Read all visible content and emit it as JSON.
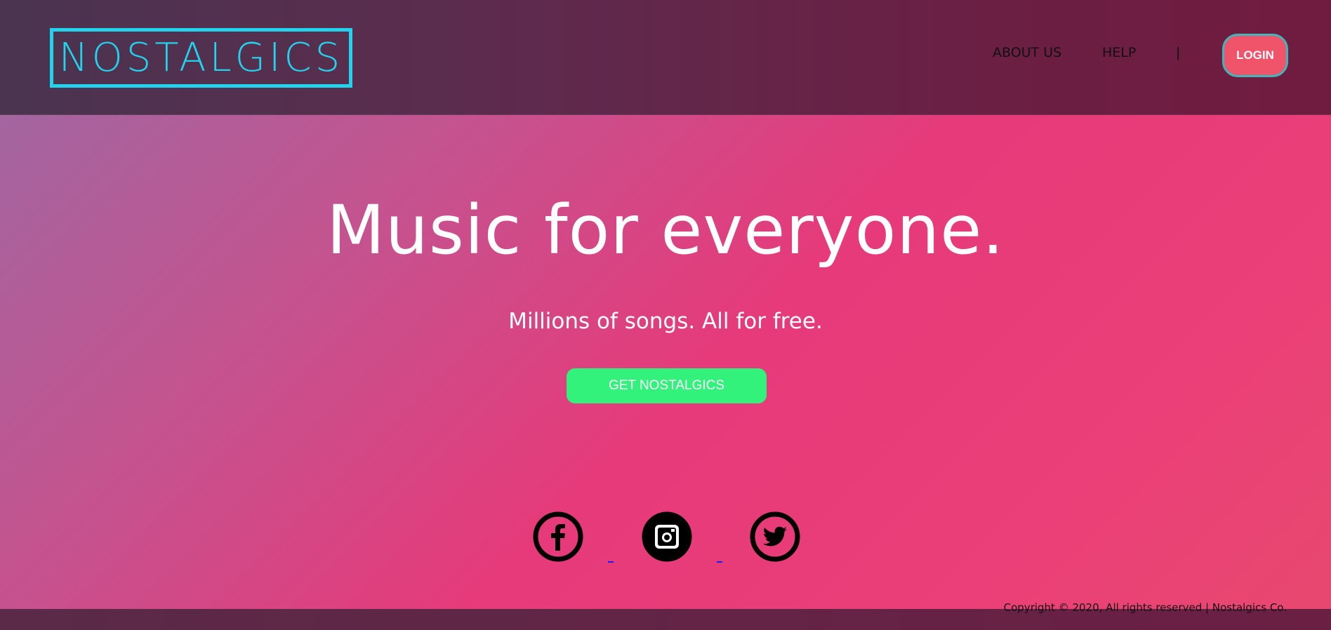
{
  "header": {
    "logo_text": "NOSTALGICS",
    "nav": {
      "about": "ABOUT US",
      "help": "HELP",
      "separator": "|"
    },
    "login_label": "LOGIN"
  },
  "hero": {
    "title": "Music for everyone.",
    "subtitle": "Millions of songs. All for free.",
    "cta_label": "GET NOSTALGICS"
  },
  "social": {
    "icons": [
      "facebook-icon",
      "instagram-icon",
      "twitter-icon"
    ]
  },
  "footer": {
    "copyright": "Copyright © 2020, All rights reserved | Nostalgics Co."
  },
  "colors": {
    "logo": "#22d3ee",
    "login_bg": "#f0546b",
    "login_border": "#3fb6ba",
    "cta_bg": "#33f27c",
    "header_bg": "#5e2a4d",
    "hero_accent": "#e63a7a"
  }
}
